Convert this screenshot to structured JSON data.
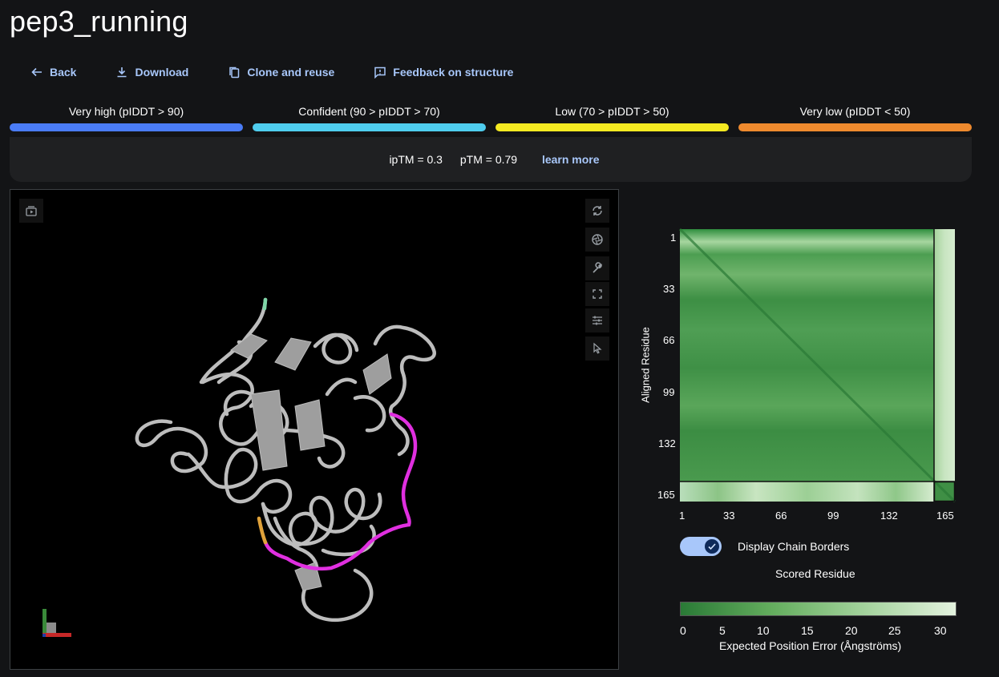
{
  "title": "pep3_running",
  "toolbar": {
    "back": "Back",
    "download": "Download",
    "clone": "Clone and reuse",
    "feedback": "Feedback on structure"
  },
  "confidence_legend": [
    {
      "label": "Very high (pIDDT > 90)",
      "color": "#4a7cf7"
    },
    {
      "label": "Confident (90 > pIDDT > 70)",
      "color": "#4fcdee"
    },
    {
      "label": "Low (70 > pIDDT > 50)",
      "color": "#f5ea21"
    },
    {
      "label": "Very low (pIDDT < 50)",
      "color": "#ee8a2e"
    }
  ],
  "metrics": {
    "iptm": "ipTM = 0.3",
    "ptm": "pTM = 0.79",
    "learn_more": "learn more"
  },
  "viewer": {
    "tool_icons": [
      "play-icon",
      "rotate-icon",
      "aperture-icon",
      "wrench-icon",
      "fullscreen-icon",
      "sliders-icon",
      "pointer-icon"
    ],
    "colors": {
      "protein": "#bdbdbd",
      "peptide": "#e02fe0",
      "peptide_low": "#e0a23a",
      "tip": "#7fd6a7"
    }
  },
  "pae": {
    "y_axis_label": "Aligned Residue",
    "y_ticks": [
      "1",
      "33",
      "66",
      "99",
      "132",
      "165"
    ],
    "x_ticks": [
      "1",
      "33",
      "66",
      "99",
      "132",
      "165"
    ],
    "toggle_label": "Display Chain Borders",
    "toggle_on": true,
    "x_axis_label": "Scored Residue",
    "scale_ticks": [
      "0",
      "5",
      "10",
      "15",
      "20",
      "25",
      "30"
    ],
    "scale_label": "Expected Position Error (Ångströms)",
    "scale_colors": [
      "#2a7a36",
      "#e3f2de"
    ]
  }
}
